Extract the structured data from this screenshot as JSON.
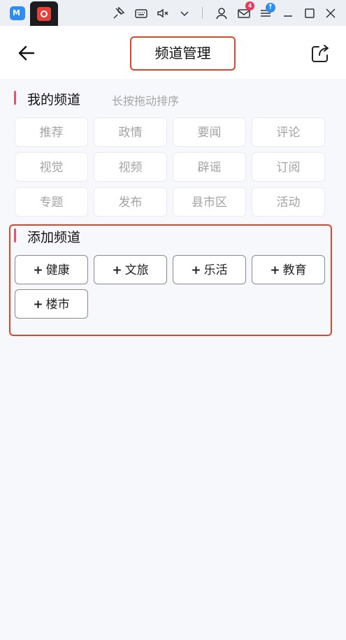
{
  "titlebar": {
    "tab_a_icon": "mumu-app-icon",
    "tab_b_icon": "news-app-icon",
    "mail_badge": "4",
    "update_badge": "↑"
  },
  "header": {
    "title": "频道管理"
  },
  "my_channels": {
    "title": "我的频道",
    "hint": "长按拖动排序",
    "items": [
      "推荐",
      "政情",
      "要闻",
      "评论",
      "视觉",
      "视频",
      "辟谣",
      "订阅",
      "专题",
      "发布",
      "县市区",
      "活动"
    ]
  },
  "add_channels": {
    "title": "添加频道",
    "plus": "+",
    "items": [
      "健康",
      "文旅",
      "乐活",
      "教育",
      "楼市"
    ]
  },
  "colors": {
    "accent_bar": "#e0566b",
    "highlight_box": "#d9472d",
    "background": "#f7f8fc"
  }
}
